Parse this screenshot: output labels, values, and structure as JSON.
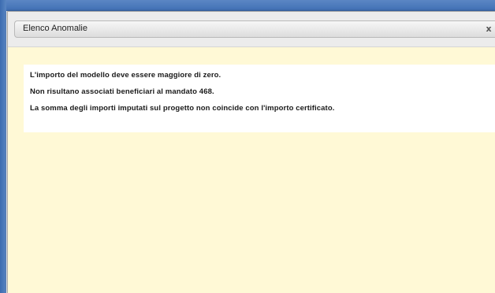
{
  "dialog": {
    "title": "Elenco Anomalie",
    "close_icon": "close-icon",
    "close_glyph": "x",
    "background_color": "#fff9d6",
    "messages": [
      "L'importo del modello deve essere maggiore di zero.",
      "Non risultano associati beneficiari al mandato 468.",
      "La somma degli importi imputati sul progetto non coincide con l'importo certificato."
    ]
  }
}
